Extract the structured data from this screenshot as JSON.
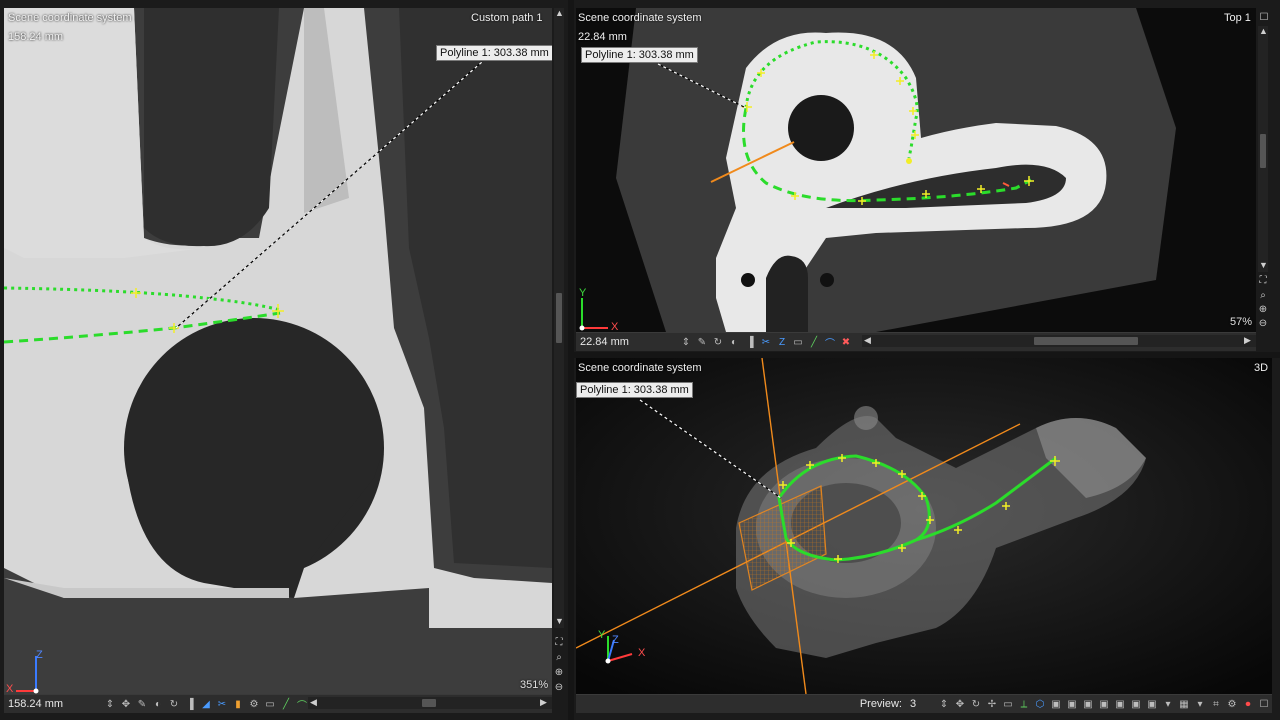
{
  "left_view": {
    "coordinate_system": "Scene coordinate system",
    "view_name": "Custom path 1",
    "scale_label": "158.24 mm",
    "measurement_label": "Polyline 1: 303.38 mm",
    "zoom": "351%",
    "scale_field": "158.24 mm",
    "axes": {
      "h": "X",
      "v": "Z"
    }
  },
  "top_view": {
    "coordinate_system": "Scene coordinate system",
    "view_name": "Top 1",
    "scale_label": "22.84 mm",
    "measurement_label": "Polyline 1: 303.38 mm",
    "zoom": "57%",
    "scale_field": "22.84 mm",
    "axes": {
      "h": "X",
      "v": "Y"
    }
  },
  "view_3d": {
    "coordinate_system": "Scene coordinate system",
    "view_name": "3D",
    "measurement_label": "Polyline 1: 303.38 mm",
    "preview_label": "Preview:",
    "preview_value": "3",
    "axes": {
      "x": "X",
      "y": "Y",
      "z": "Z"
    }
  },
  "colors": {
    "path_green": "#2bdc2b",
    "cursor_orange": "#f08a1c",
    "marker_yellow": "#f2ee26"
  },
  "icons": [
    "pan-icon",
    "brightness-icon",
    "reset-icon",
    "grayscale-icon",
    "cut-icon",
    "gear-icon",
    "ruler-icon",
    "line-tool-icon",
    "delete-icon",
    "zoom-fit-icon",
    "zoom-in-icon",
    "zoom-out-icon",
    "maximize-icon"
  ]
}
